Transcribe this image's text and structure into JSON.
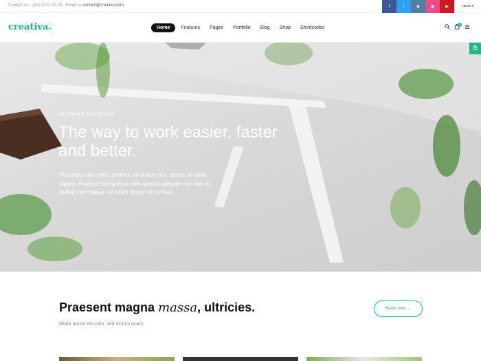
{
  "topbar": {
    "contact_prefix": "Contact us – (30) 2222-33-24 · Email us",
    "email": "contact@creativa.com",
    "social": [
      {
        "icon": "facebook-icon",
        "glyph": "f",
        "color": "#3b5998"
      },
      {
        "icon": "twitter-icon",
        "glyph": "t",
        "color": "#2aa3ef"
      },
      {
        "icon": "instagram-icon",
        "glyph": "◙",
        "color": "#517fa4"
      },
      {
        "icon": "dribbble-icon",
        "glyph": "◉",
        "color": "#ea4c89"
      },
      {
        "icon": "youtube-icon",
        "glyph": "▶",
        "color": "#cc181e"
      }
    ],
    "user_label": "yanzo ▾"
  },
  "header": {
    "logo": "creativa.",
    "nav": [
      "Home",
      "Features",
      "Pages",
      "Portfolio",
      "Blog",
      "Shop",
      "Shortcodes"
    ],
    "active_nav": "Home",
    "search_icon": "search-icon",
    "cart_icon": "cart-icon",
    "cart_count": "0",
    "menu_icon": "menu-icon"
  },
  "hero": {
    "eyebrow": "ULTIMATE SOLUTION",
    "title": "The way to work easier, faster and better.",
    "text": "Phasellus odio tortor, pretium vel ornare nec, dictum sit amet sapien. Praesent ac ligula ac sem gravida aliquam non quis ex. Nullam non massa vel lorem dictum accumsan."
  },
  "side_tab_icon": "cart-tab-icon",
  "section": {
    "title_part1": "Praesent magna ",
    "title_italic": "massa",
    "title_part2": ", ultricies.",
    "subtitle": "Morbi auctor est odio, sed dictum quam.",
    "button": "Read more →"
  },
  "colors": {
    "accent": "#1cb78b"
  }
}
